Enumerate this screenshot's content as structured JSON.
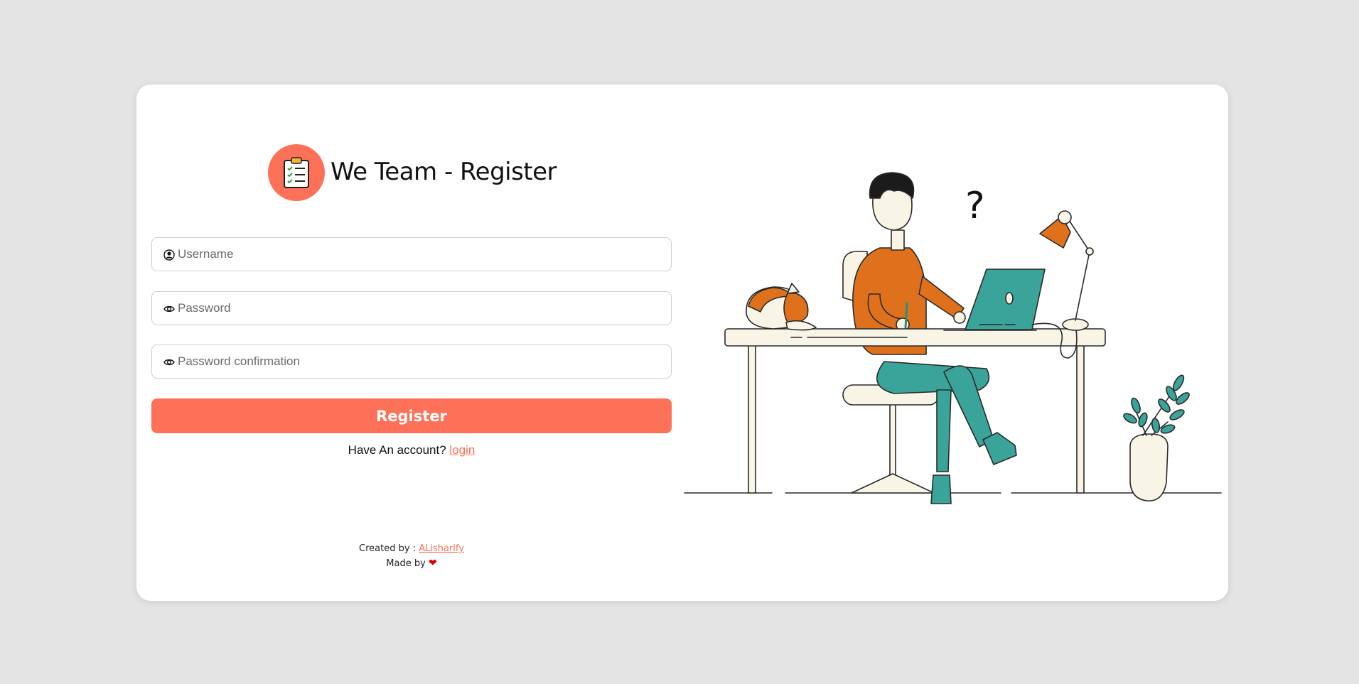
{
  "brand": {
    "title": "We Team - Register",
    "logo_icon": "clipboard-checklist-icon",
    "logo_bg": "#fd7158"
  },
  "form": {
    "username": {
      "placeholder": "Username",
      "value": "",
      "icon": "user-circle-icon"
    },
    "password": {
      "placeholder": "Password",
      "value": "",
      "icon": "eye-icon"
    },
    "password_confirmation": {
      "placeholder": "Password confirmation",
      "value": "",
      "icon": "eye-icon"
    },
    "submit_label": "Register"
  },
  "account": {
    "prompt": "Have An account?",
    "link_label": "login"
  },
  "footer": {
    "created_by_label": "Created by :",
    "author": "ALisharify",
    "made_by_label": "Made by",
    "heart": "❤"
  },
  "colors": {
    "accent": "#fd7158",
    "background": "#e4e4e4",
    "card": "#ffffff"
  }
}
